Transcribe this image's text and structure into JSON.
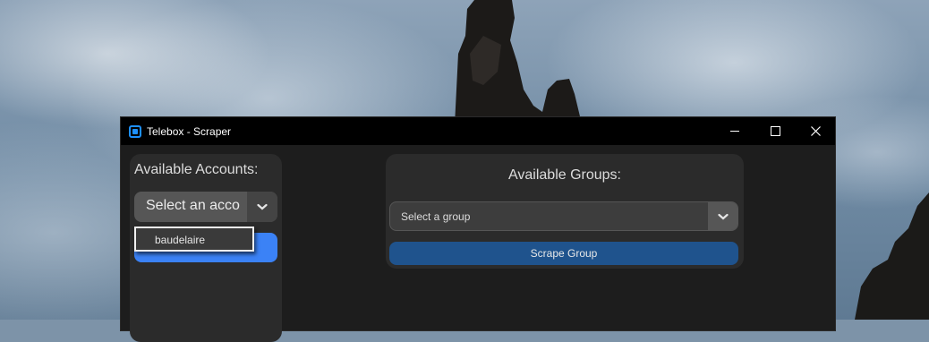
{
  "window": {
    "title": "Telebox - Scraper"
  },
  "accounts": {
    "label": "Available Accounts:",
    "selected_text": "Select an account",
    "dropdown_items": [
      "baudelaire"
    ]
  },
  "groups": {
    "label": "Available Groups:",
    "selected_text": "Select a group",
    "scrape_button_label": "Scrape Group"
  },
  "icons": {
    "app": "telebox-app-icon",
    "minimize": "minimize-icon",
    "maximize": "maximize-icon",
    "close": "close-icon",
    "dropdown": "chevron-down-icon"
  },
  "colors": {
    "accent_blue": "#3b82f6",
    "scrape_button": "#1f538d",
    "window_bg": "#1d1d1d",
    "panel_bg": "#2b2b2b"
  }
}
